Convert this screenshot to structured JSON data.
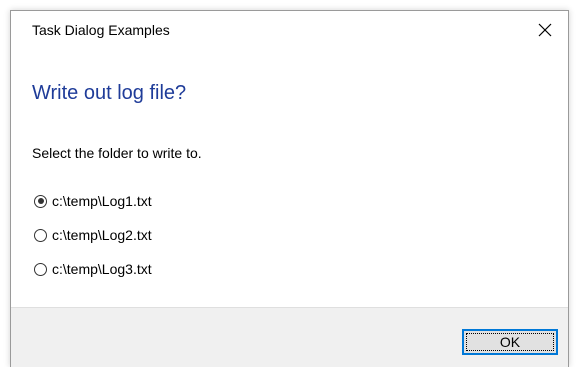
{
  "window": {
    "title": "Task Dialog Examples"
  },
  "dialog": {
    "main_instruction": "Write out log file?",
    "content": "Select the folder to write to.",
    "options": [
      {
        "label": "c:\\temp\\Log1.txt",
        "checked": true
      },
      {
        "label": "c:\\temp\\Log2.txt",
        "checked": false
      },
      {
        "label": "c:\\temp\\Log3.txt",
        "checked": false
      }
    ],
    "ok_label": "OK"
  },
  "colors": {
    "main_instruction": "#1f3c99",
    "button_focus_border": "#0078d7",
    "footer_background": "#f0f0f0"
  }
}
